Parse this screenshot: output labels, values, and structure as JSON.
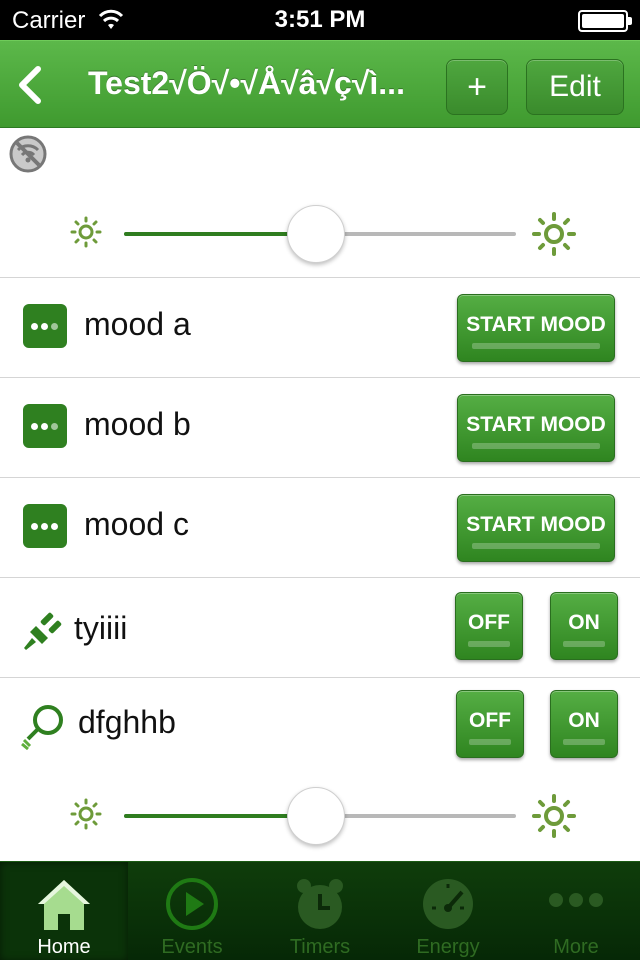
{
  "status_bar": {
    "carrier": "Carrier",
    "time": "3:51 PM"
  },
  "nav": {
    "title": "Test2√Ö√•√Å√â√ç√ì...",
    "add_label": "+",
    "edit_label": "Edit"
  },
  "icons": {
    "back": "chevron-left-icon",
    "offline": "wifi-off-icon",
    "brightness_low": "sun-small-icon",
    "brightness_high": "sun-large-icon"
  },
  "colors": {
    "accent": "#3f9a2f",
    "dark_green": "#2f7d1f",
    "tabbar": "#0f3d0b"
  },
  "slider_top": {
    "value_fraction": 0.49
  },
  "moods": [
    {
      "name": "mood a",
      "button": "START MOOD"
    },
    {
      "name": "mood b",
      "button": "START MOOD"
    },
    {
      "name": "mood c",
      "button": "START MOOD"
    }
  ],
  "devices": [
    {
      "name": "tyiiii",
      "icon": "plug-icon",
      "off_label": "OFF",
      "on_label": "ON"
    },
    {
      "name": "dfghhb",
      "icon": "bulb-icon",
      "off_label": "OFF",
      "on_label": "ON"
    }
  ],
  "slider_bottom": {
    "value_fraction": 0.49
  },
  "tabs": [
    {
      "label": "Home",
      "icon": "home-icon",
      "active": true
    },
    {
      "label": "Events",
      "icon": "play-icon",
      "active": false
    },
    {
      "label": "Timers",
      "icon": "alarm-clock-icon",
      "active": false
    },
    {
      "label": "Energy",
      "icon": "gauge-icon",
      "active": false
    },
    {
      "label": "More",
      "icon": "more-icon",
      "active": false
    }
  ]
}
